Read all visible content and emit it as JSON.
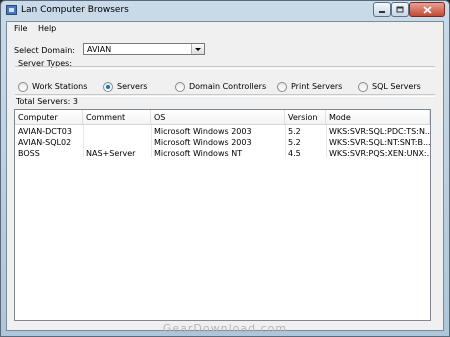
{
  "window": {
    "title": "Lan Computer Browsers",
    "minimize_icon": "minimize-icon",
    "maximize_icon": "maximize-icon",
    "close_icon": "close-icon"
  },
  "menu": {
    "file": "File",
    "help": "Help"
  },
  "domain": {
    "label": "Select Domain:",
    "value": "AVIAN"
  },
  "server_types": {
    "label": "Server Types:",
    "options": [
      {
        "label": "Work Stations",
        "checked": false
      },
      {
        "label": "Servers",
        "checked": true
      },
      {
        "label": "Domain Controllers",
        "checked": false
      },
      {
        "label": "Print Servers",
        "checked": false
      },
      {
        "label": "SQL Servers",
        "checked": false
      }
    ]
  },
  "total": "Total Servers: 3",
  "table": {
    "columns": [
      "Computer",
      "Comment",
      "OS",
      "Version",
      "Mode"
    ],
    "rows": [
      [
        "AVIAN-DCT03",
        "",
        "Microsoft Windows 2003",
        "5.2",
        "WKS:SVR:SQL:PDC:TS:N..."
      ],
      [
        "AVIAN-SQL02",
        "",
        "Microsoft Windows 2003",
        "5.2",
        "WKS:SVR:SQL:NT:SNT:B..."
      ],
      [
        "BOSS",
        "NAS+Server",
        "Microsoft Windows NT",
        "4.5",
        "WKS:SVR:PQS:XEN:UNX:..."
      ]
    ]
  },
  "watermark": "GearDownload.com",
  "colors": {
    "accent_radio": "#1a6fc4",
    "close_button": "#c24a34"
  }
}
